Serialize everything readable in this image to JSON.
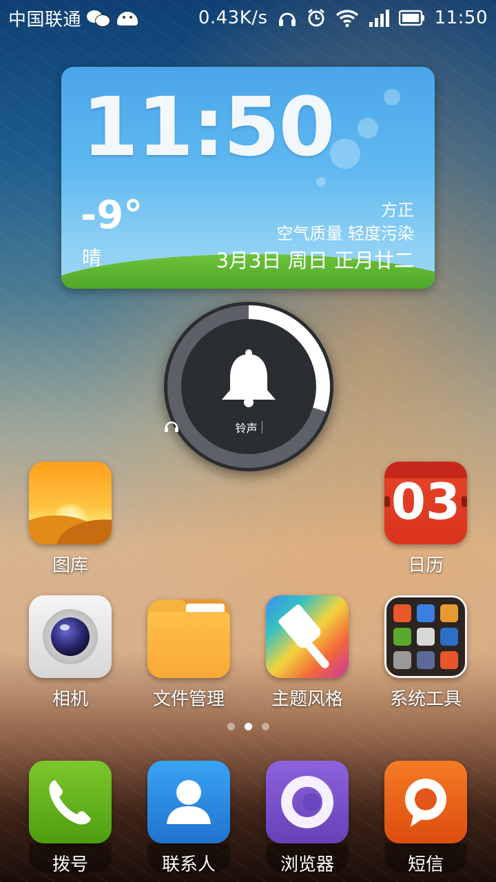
{
  "status_bar": {
    "carrier": "中国联通",
    "net_speed": "0.43K/s",
    "time": "11:50",
    "icons": [
      "wechat-icon",
      "android-icon",
      "headphone-icon",
      "alarm-icon",
      "wifi-icon",
      "signal-icon",
      "battery-icon"
    ]
  },
  "widget": {
    "time": "11:50",
    "temperature": "-9°",
    "condition": "晴",
    "location": "方正",
    "air_quality": "空气质量 轻度污染",
    "date": "3月3日 周日 正月廿二"
  },
  "ringer": {
    "label": "铃声",
    "level": 0.3,
    "icons": [
      "bell-icon",
      "headphone-icon"
    ]
  },
  "home": {
    "row1": [
      {
        "label": "图库",
        "icon": "gallery-icon"
      },
      {
        "label": "日历",
        "icon": "calendar-icon",
        "badge": "03"
      }
    ],
    "row2": [
      {
        "label": "相机",
        "icon": "camera-icon"
      },
      {
        "label": "文件管理",
        "icon": "folder-icon"
      },
      {
        "label": "主题风格",
        "icon": "paintbrush-icon"
      },
      {
        "label": "系统工具",
        "icon": "tools-folder-icon"
      }
    ],
    "page_count": 3,
    "current_page": 2
  },
  "dock": [
    {
      "label": "拨号",
      "icon": "phone-icon"
    },
    {
      "label": "联系人",
      "icon": "contacts-icon"
    },
    {
      "label": "浏览器",
      "icon": "browser-icon"
    },
    {
      "label": "短信",
      "icon": "sms-icon"
    }
  ],
  "colors": {
    "ringer_arc": "#ffffff",
    "calendar_red": "#e8452b",
    "grass_green": "#3f9a20"
  }
}
